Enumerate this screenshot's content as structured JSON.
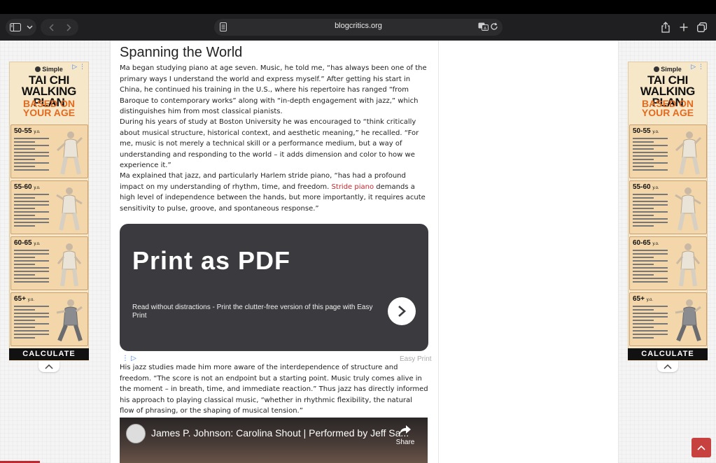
{
  "browser": {
    "url": "blogcritics.org"
  },
  "ads": {
    "brand": "Simple",
    "title_lines": [
      "TAI CHI",
      "WALKING PLAN"
    ],
    "subtitle_lines": [
      "BASED ON",
      "YOUR AGE"
    ],
    "age_groups": [
      "50-55",
      "55-60",
      "60-65",
      "65+"
    ],
    "age_suffix": "y.o.",
    "cta": "CALCULATE"
  },
  "article": {
    "heading": "Spanning the World",
    "paragraphs": [
      "Ma began studying piano at age seven. Music, he told me, “has always been one of the primary ways I understand the world and express myself.” After getting his start in China, he continued his training in the U.S., where his repertoire has ranged “from Baroque to contemporary works” along with “in-depth engagement with jazz,” which distinguishes him from most classical pianists.",
      "During his years of study at Boston University he was encouraged to “think critically about musical structure, historical context, and aesthetic meaning,” he recalled. “For me, music is not merely a technical skill or a performance medium, but a way of understanding and responding to the world – it adds dimension and color to how we experience it.”"
    ],
    "para3_before": "Ma explained that jazz, and particularly Harlem stride piano, “has had a profound impact on my understanding of rhythm, time, and freedom.",
    "para3_link": "Stride piano",
    "para3_after": " demands a high level of independence between the hands, but more importantly, it requires acute sensitivity to pulse, groove, and spontaneous response.”",
    "para4": "His jazz studies made him more aware of the interdependence of structure and freedom. “The score is not an endpoint but a starting point. Music truly comes alive in the moment – in breath, time, and immediate reaction.” Thus jazz has directly informed his approach to playing classical music, “whether in rhythmic flexibility, the natural flow of phrasing, or the shaping of musical tension.”"
  },
  "print_card": {
    "title": "Print as PDF",
    "description": "Read without distractions - Print the clutter-free version of this page with Easy Print",
    "brand": "Easy Print"
  },
  "video": {
    "title": "James P. Johnson: Carolina Shout | Performed by Jeff Sa...",
    "share_label": "Share"
  },
  "reading_progress": 0.056
}
